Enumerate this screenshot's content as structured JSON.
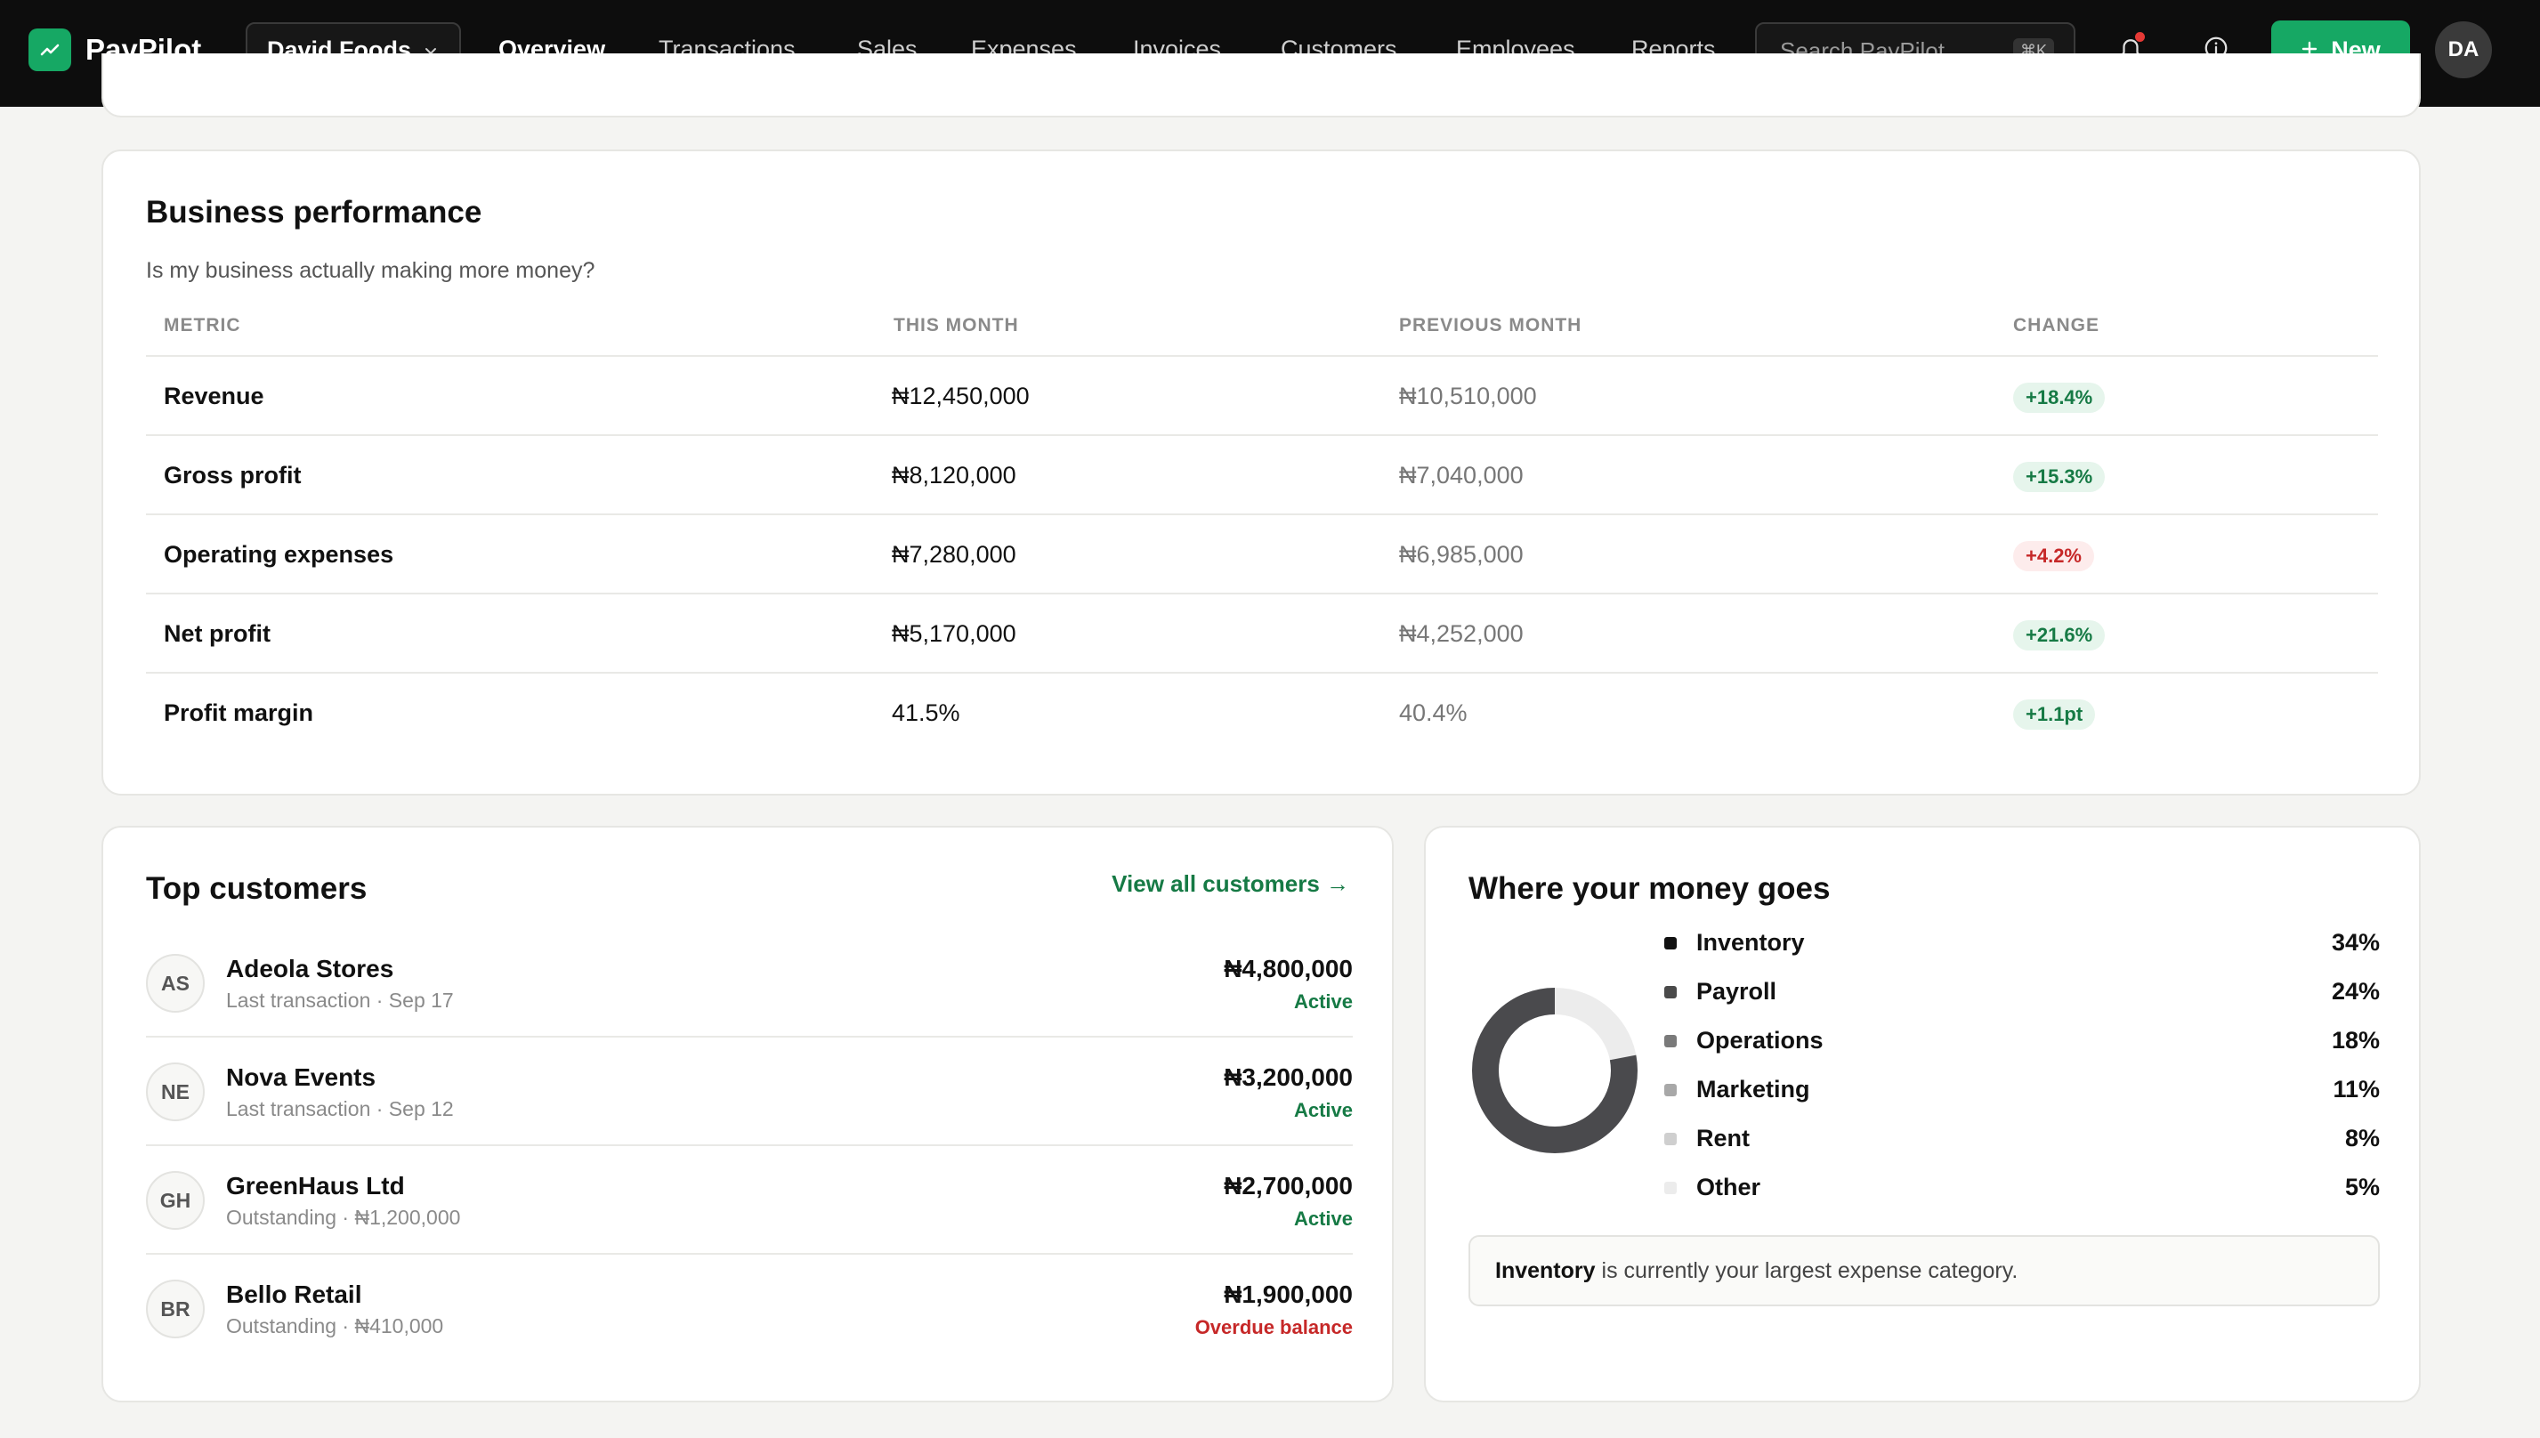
{
  "app": {
    "name": "PayPilot",
    "business": "David Foods",
    "search_placeholder": "Search PayPilot...",
    "search_shortcut": "⌘K",
    "new_label": "New",
    "user_initials": "DA"
  },
  "nav": [
    {
      "label": "Overview",
      "active": true
    },
    {
      "label": "Transactions"
    },
    {
      "label": "Sales"
    },
    {
      "label": "Expenses"
    },
    {
      "label": "Invoices"
    },
    {
      "label": "Customers"
    },
    {
      "label": "Employees"
    },
    {
      "label": "Reports"
    }
  ],
  "performance": {
    "title": "Business performance",
    "subtitle": "Is my business actually making more money?",
    "headers": {
      "metric": "METRIC",
      "this_month": "THIS MONTH",
      "previous_month": "PREVIOUS MONTH",
      "change": "CHANGE"
    },
    "rows": [
      {
        "metric": "Revenue",
        "this_month": "₦12,450,000",
        "previous_month": "₦10,510,000",
        "change": "+18.4%",
        "trend": "up"
      },
      {
        "metric": "Gross profit",
        "this_month": "₦8,120,000",
        "previous_month": "₦7,040,000",
        "change": "+15.3%",
        "trend": "up"
      },
      {
        "metric": "Operating expenses",
        "this_month": "₦7,280,000",
        "previous_month": "₦6,985,000",
        "change": "+4.2%",
        "trend": "down"
      },
      {
        "metric": "Net profit",
        "this_month": "₦5,170,000",
        "previous_month": "₦4,252,000",
        "change": "+21.6%",
        "trend": "up"
      },
      {
        "metric": "Profit margin",
        "this_month": "41.5%",
        "previous_month": "40.4%",
        "change": "+1.1pt",
        "trend": "up"
      }
    ]
  },
  "customers": {
    "title": "Top customers",
    "view_all": "View all customers →",
    "items": [
      {
        "initials": "AS",
        "name": "Adeola Stores",
        "meta": "Last transaction · Sep 17",
        "amount": "₦4,800,000",
        "status": "Active",
        "status_type": "ok"
      },
      {
        "initials": "NE",
        "name": "Nova Events",
        "meta": "Last transaction · Sep 12",
        "amount": "₦3,200,000",
        "status": "Active",
        "status_type": "ok"
      },
      {
        "initials": "GH",
        "name": "GreenHaus Ltd",
        "meta": "Outstanding · ₦1,200,000",
        "amount": "₦2,700,000",
        "status": "Active",
        "status_type": "ok"
      },
      {
        "initials": "BR",
        "name": "Bello Retail",
        "meta": "Outstanding · ₦410,000",
        "amount": "₦1,900,000",
        "status": "Overdue balance",
        "status_type": "bad"
      }
    ]
  },
  "money": {
    "title": "Where your money goes",
    "categories": [
      {
        "label": "Inventory",
        "pct": "34%",
        "value": 34,
        "color": "#111111"
      },
      {
        "label": "Payroll",
        "pct": "24%",
        "value": 24,
        "color": "#4a4a4a"
      },
      {
        "label": "Operations",
        "pct": "18%",
        "value": 18,
        "color": "#7a7a7a"
      },
      {
        "label": "Marketing",
        "pct": "11%",
        "value": 11,
        "color": "#a8a8a8"
      },
      {
        "label": "Rent",
        "pct": "8%",
        "value": 8,
        "color": "#cfcfcf"
      },
      {
        "label": "Other",
        "pct": "5%",
        "value": 5,
        "color": "#ececec"
      }
    ],
    "donut": {
      "filled_fraction": 0.78,
      "fill_color": "#4a4a4d",
      "track_color": "#ececec"
    },
    "callout_bold": "Inventory",
    "callout_text": "is currently your largest expense category."
  }
}
